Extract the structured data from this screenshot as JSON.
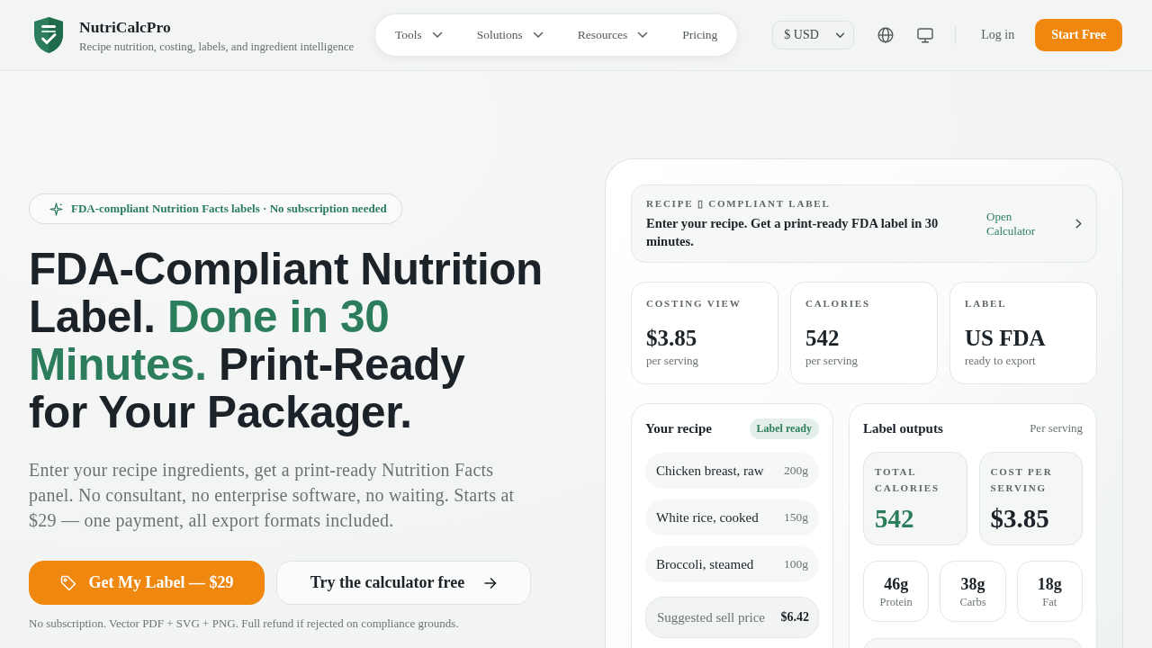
{
  "header": {
    "brand": {
      "name": "NutriCalcPro",
      "tagline": "Recipe nutrition, costing, labels, and ingredient intelligence"
    },
    "nav": [
      {
        "label": "Tools",
        "has_menu": true
      },
      {
        "label": "Solutions",
        "has_menu": true
      },
      {
        "label": "Resources",
        "has_menu": true
      },
      {
        "label": "Pricing",
        "has_menu": false
      }
    ],
    "currency": "$ USD",
    "login": "Log in",
    "cta": "Start Free"
  },
  "hero": {
    "badge": "FDA-compliant Nutrition Facts labels · No subscription needed",
    "headline": [
      [
        {
          "text": "FDA-Compliant Nutrition",
          "highlight": false
        }
      ],
      [
        {
          "text": "Label. ",
          "highlight": false
        },
        {
          "text": "Done in 30",
          "highlight": true
        }
      ],
      [
        {
          "text": "Minutes.",
          "highlight": true
        },
        {
          "text": " Print-Ready",
          "highlight": false
        }
      ],
      [
        {
          "text": "for Your Packager.",
          "highlight": false
        }
      ]
    ],
    "description": "Enter your recipe ingredients, get a print-ready Nutrition Facts panel. No consultant, no enterprise software, no waiting. Starts at $29 — one payment, all export formats included.",
    "primary_button": "Get My Label — $29",
    "secondary_button": "Try the calculator free",
    "footnote": "No subscription. Vector PDF + SVG + PNG. Full refund if rejected on compliance grounds."
  },
  "preview": {
    "banner": {
      "eyebrow": "RECIPE ▯ COMPLIANT LABEL",
      "title": "Enter your recipe. Get a print-ready FDA label in 30 minutes.",
      "link": "Open Calculator"
    },
    "stats": [
      {
        "label": "COSTING VIEW",
        "value": "$3.85",
        "caption": "per serving"
      },
      {
        "label": "CALORIES",
        "value": "542",
        "caption": "per serving"
      },
      {
        "label": "LABEL",
        "value": "US FDA",
        "caption": "ready to export"
      }
    ],
    "recipe": {
      "title": "Your recipe",
      "status": "Label ready",
      "ingredients": [
        {
          "name": "Chicken breast, raw",
          "amount": "200g"
        },
        {
          "name": "White rice, cooked",
          "amount": "150g"
        },
        {
          "name": "Broccoli, steamed",
          "amount": "100g"
        }
      ],
      "price_label": "Suggested sell price",
      "price_value": "$6.42"
    },
    "outputs": {
      "title": "Label outputs",
      "note": "Per serving",
      "totals": [
        {
          "label": "TOTAL CALORIES",
          "value": "542",
          "highlight": true
        },
        {
          "label": "COST PER SERVING",
          "value": "$3.85",
          "highlight": false
        }
      ],
      "macros": [
        {
          "value": "46g",
          "label": "Protein"
        },
        {
          "value": "38g",
          "label": "Carbs"
        },
        {
          "value": "18g",
          "label": "Fat"
        }
      ]
    }
  }
}
